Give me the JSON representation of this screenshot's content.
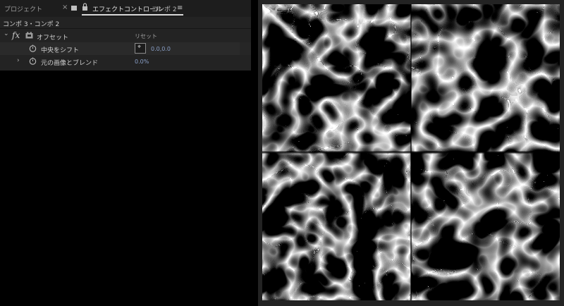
{
  "tabs": {
    "project": "プロジェクト",
    "close_glyph": "×",
    "effect_controls": "エフェクトコントロール",
    "comp": "コンポ 2",
    "menu_glyph": "≡"
  },
  "breadcrumb": "コンポ 3・コンポ 2",
  "effect": {
    "twirl_glyph": "⌄",
    "fx_glyph": "fx",
    "name": "オフセット",
    "reset": "リセット"
  },
  "properties": [
    {
      "label": "中央をシフト",
      "value": "0.0,0.0",
      "anchor_glyph": "⌖"
    },
    {
      "twirl_glyph": "›",
      "label": "元の画像とブレンド",
      "value": "0.0%"
    }
  ],
  "colors": {
    "panel_bg": "#232323",
    "value_blue": "#8aa0c8",
    "canvas_bg": "#000000"
  }
}
